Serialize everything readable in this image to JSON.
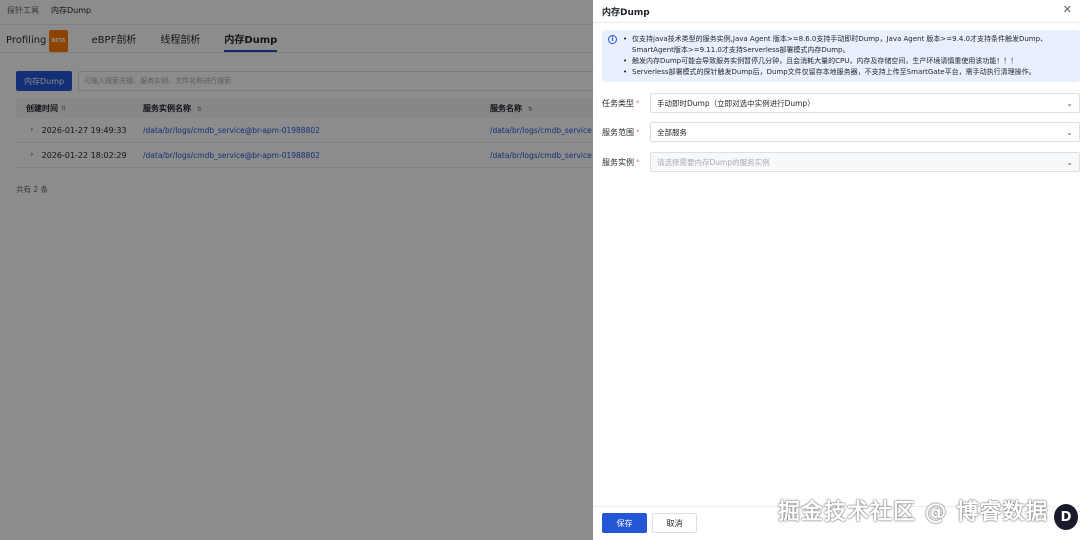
{
  "breadcrumb": {
    "parent": "探针工具",
    "current": "内存Dump"
  },
  "tabs": [
    {
      "label": "Profiling",
      "badge": "BETA"
    },
    {
      "label": "eBPF剖析"
    },
    {
      "label": "线程剖析"
    },
    {
      "label": "内存Dump",
      "active": true
    }
  ],
  "toolbar": {
    "dump_button": "内存Dump",
    "search_placeholder": "可输入搜索关键、服务实例、文件名称进行搜索"
  },
  "table": {
    "headers": [
      "创建时间",
      "服务实例名称",
      "服务名称"
    ],
    "rows": [
      {
        "time": "2026-01-27 19:49:33",
        "instance": "/data/br/logs/cmdb_service@br-apm-01988802",
        "service": "/data/br/logs/cmdb_service"
      },
      {
        "time": "2026-01-22 18:02:29",
        "instance": "/data/br/logs/cmdb_service@br-apm-01988802",
        "service": "/data/br/logs/cmdb_service"
      }
    ],
    "total": "共有 2 条"
  },
  "drawer": {
    "title": "内存Dump",
    "notes": [
      "仅支持java技术类型的服务实例,Java Agent 版本>=8.6.0支持手动即时Dump，Java Agent 版本>=9.4.0才支持条件触发Dump、SmartAgent版本>=9.11.0才支持Serverless部署模式内存Dump。",
      "触发内存Dump可能会导致服务实例暂停几分钟，且会消耗大量的CPU，内存及存储空间，生产环境请慎重使用该功能！！！",
      "Serverless部署模式的探针触发Dump后，Dump文件仅留存本地服务器，不支持上传至SmartGate平台，需手动执行清理操作。"
    ],
    "form": {
      "task_type": {
        "label": "任务类型",
        "value": "手动即时Dump（立即对选中实例进行Dump）"
      },
      "service_scope": {
        "label": "服务范围",
        "value": "全部服务"
      },
      "service_instance": {
        "label": "服务实例",
        "placeholder": "请选择需要内存Dump的服务实例"
      }
    },
    "save_label": "保存",
    "cancel_label": "取消"
  },
  "watermark": "掘金技术社区 @ 博睿数据",
  "colors": {
    "primary": "#2456d6",
    "alert_bg": "#e8f0fe",
    "required": "#f56c6c",
    "beta": "#ff7d00"
  }
}
